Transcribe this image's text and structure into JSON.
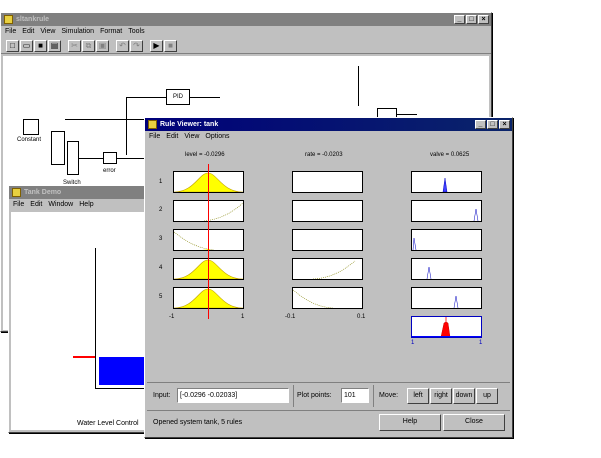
{
  "simulink": {
    "title": "sltankrule",
    "menu": [
      "File",
      "Edit",
      "View",
      "Simulation",
      "Format",
      "Tools"
    ],
    "blocks": {
      "pid": "PID",
      "constant": "Constant",
      "switch": "Switch",
      "error": "error"
    }
  },
  "tank": {
    "title": "Tank Demo",
    "menu": [
      "File",
      "Edit",
      "Window",
      "Help"
    ],
    "caption": "Water Level Control",
    "water_color": "#0000ff",
    "setpoint_color": "#ff0000"
  },
  "ruleviewer": {
    "title": "Rule Viewer: tank",
    "menu": [
      "File",
      "Edit",
      "View",
      "Options"
    ],
    "col_headers": [
      "level = -0.0296",
      "rate = -0.0203",
      "valve = 0.0625"
    ],
    "rule_numbers": [
      "1",
      "2",
      "3",
      "4",
      "5"
    ],
    "axis_left": [
      "-1",
      "1"
    ],
    "axis_mid": [
      "-0.1",
      "0.1"
    ],
    "axis_right": [
      "1",
      "1"
    ],
    "input_label": "Input:",
    "input_value": "[-0.0296 -0.02033]",
    "plot_points_label": "Plot points:",
    "plot_points_value": "101",
    "move_label": "Move:",
    "move_buttons": [
      "left",
      "right",
      "down",
      "up"
    ],
    "status": "Opened system tank, 5 rules",
    "help_button": "Help",
    "close_button": "Close"
  }
}
